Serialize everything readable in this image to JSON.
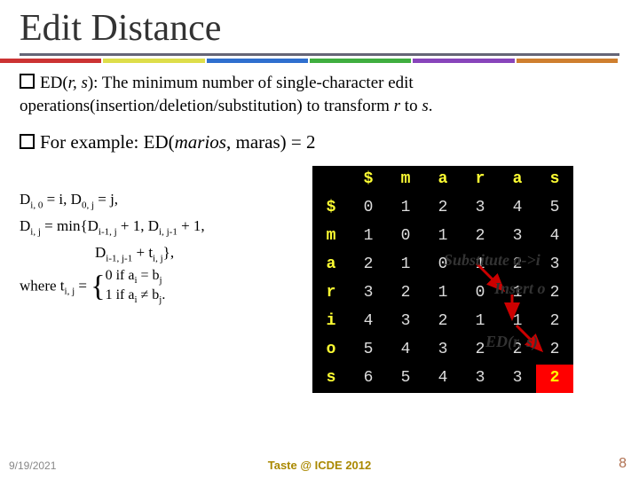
{
  "title": "Edit Distance",
  "accents": [
    "#cc3333",
    "#dede4a",
    "#2f6fcf",
    "#3fae3f",
    "#8844bb",
    "#cf7f2f"
  ],
  "bullet1_a": "ED(",
  "bullet1_b": "r, s",
  "bullet1_c": "): The minimum number of single-character edit operations(insertion/deletion/substitution) to transform ",
  "bullet1_d": "r",
  "bullet1_e": " to ",
  "bullet1_f": "s",
  "bullet1_g": ".",
  "bullet2_a": "For example:   ED(",
  "bullet2_b": "marios",
  "bullet2_c": ", maras) = 2",
  "formulas": {
    "l1": "D",
    "l1s1": "i, 0",
    "l1b": " = i,     D",
    "l1s2": "0, j",
    "l1c": " = j,",
    "l2": "D",
    "l2s1": "i, j",
    "l2b": " = min{D",
    "l2s2": "i-1, j",
    "l2c": " + 1, D",
    "l2s3": "i, j-1",
    "l2d": " + 1,",
    "l3": "                    D",
    "l3s1": "i-1, j-1",
    "l3b": " + t",
    "l3s2": "i, j",
    "l3c": "},",
    "l4": "where  t",
    "l4s1": "i, j",
    "l4b": " = ",
    "piece_top": "0 if a",
    "piece_top_s": "i",
    "piece_top_b": " = b",
    "piece_top_s2": "j",
    "piece_bot": "1 if a",
    "piece_bot_s": "i",
    "piece_bot_b": " ≠ b",
    "piece_bot_s2": "j",
    "piece_bot_c": "."
  },
  "table": {
    "cols": [
      "$",
      "m",
      "a",
      "r",
      "a",
      "s"
    ],
    "rows": [
      "$",
      "m",
      "a",
      "r",
      "i",
      "o",
      "s"
    ],
    "data": [
      [
        0,
        1,
        2,
        3,
        4,
        5
      ],
      [
        1,
        0,
        1,
        2,
        3,
        4
      ],
      [
        2,
        1,
        0,
        1,
        2,
        3
      ],
      [
        3,
        2,
        1,
        0,
        1,
        2
      ],
      [
        4,
        3,
        2,
        1,
        1,
        2
      ],
      [
        5,
        4,
        3,
        2,
        2,
        2
      ],
      [
        6,
        5,
        4,
        3,
        3,
        2
      ]
    ]
  },
  "annotations": {
    "sub": "Substitute a->i",
    "ins": "Insert o",
    "ed": "ED(r, s)"
  },
  "footer": {
    "left": "9/19/2021",
    "center": "Taste @ ICDE 2012",
    "right": "8"
  }
}
